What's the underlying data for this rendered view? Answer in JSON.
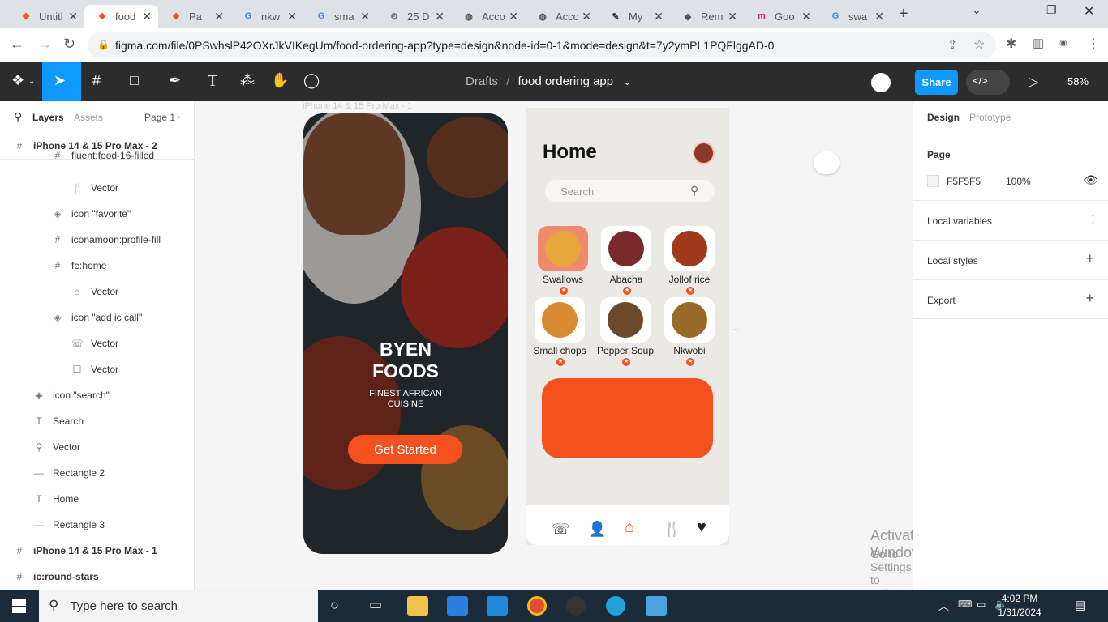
{
  "browser": {
    "tabs": [
      {
        "title": "Untitled",
        "favicon": "figma-icon"
      },
      {
        "title": "food ordering app",
        "favicon": "figma-icon",
        "active": true
      },
      {
        "title": "Pa",
        "favicon": "figma-icon"
      },
      {
        "title": "nkw",
        "favicon": "google-icon"
      },
      {
        "title": "sma",
        "favicon": "google-icon"
      },
      {
        "title": "25 D",
        "favicon": "tool-icon"
      },
      {
        "title": "Acco",
        "favicon": "globe-icon"
      },
      {
        "title": "Acco",
        "favicon": "globe-icon"
      },
      {
        "title": "My",
        "favicon": "pen-icon"
      },
      {
        "title": "Rem",
        "favicon": "layers-icon"
      },
      {
        "title": "Goo",
        "favicon": "m-icon"
      },
      {
        "title": "swa",
        "favicon": "google-icon"
      }
    ],
    "url": "figma.com/file/0PSwhslP42OXrJkVIKegUm/food-ordering-app?type=design&node-id=0-1&mode=design&t=7y2ymPL1PQFlggAD-0"
  },
  "figma": {
    "breadcrumb_parent": "Drafts",
    "breadcrumb_sep": "/",
    "file_name": "food ordering app",
    "share_label": "Share",
    "zoom": "58%"
  },
  "left_panel": {
    "tab_layers": "Layers",
    "tab_assets": "Assets",
    "page_selector": "Page 1",
    "layers": [
      {
        "name": "iPhone 14 & 15 Pro Max - 2",
        "icon": "#",
        "indent": 0,
        "bold": true
      },
      {
        "name": "fluent:food-16-filled",
        "icon": "#",
        "indent": 2
      },
      {
        "name": "Vector",
        "icon": "🍴",
        "indent": 3
      },
      {
        "name": "icon \"favorite\"",
        "icon": "◈",
        "indent": 2
      },
      {
        "name": "iconamoon:profile-fill",
        "icon": "#",
        "indent": 2
      },
      {
        "name": "fe:home",
        "icon": "#",
        "indent": 2
      },
      {
        "name": "Vector",
        "icon": "⌂",
        "indent": 3
      },
      {
        "name": "icon \"add ic call\"",
        "icon": "◈",
        "indent": 2
      },
      {
        "name": "Vector",
        "icon": "☏",
        "indent": 3
      },
      {
        "name": "Vector",
        "icon": "☐",
        "indent": 3
      },
      {
        "name": "icon \"search\"",
        "icon": "◈",
        "indent": 1
      },
      {
        "name": "Search",
        "icon": "T",
        "indent": 1
      },
      {
        "name": "Vector",
        "icon": "⚲",
        "indent": 1
      },
      {
        "name": "Rectangle 2",
        "icon": "—",
        "indent": 1
      },
      {
        "name": "Home",
        "icon": "T",
        "indent": 1
      },
      {
        "name": "Rectangle 3",
        "icon": "—",
        "indent": 1
      },
      {
        "name": "iPhone 14 & 15 Pro Max - 1",
        "icon": "#",
        "indent": 0,
        "bold": true
      },
      {
        "name": "ic:round-stars",
        "icon": "#",
        "indent": 0,
        "bold": true
      }
    ]
  },
  "canvas": {
    "frame_label": "iPhone 14 & 15 Pro Max - 1",
    "splash": {
      "brand_line1": "BYEN",
      "brand_line2": "FOODS",
      "tagline_line1": "FINEST AFRICAN",
      "tagline_line2": "CUISINE",
      "cta": "Get Started"
    },
    "home": {
      "title": "Home",
      "search_placeholder": "Search",
      "categories": [
        "Swallows",
        "Abacha",
        "Jollof rice",
        "Small chops",
        "Pepper Soup",
        "Nkwobi"
      ],
      "accent_color": "#F4511E"
    },
    "watermark_line1": "Activate Windows",
    "watermark_line2": "Go to Settings to activate Windows."
  },
  "right_panel": {
    "tab_design": "Design",
    "tab_prototype": "Prototype",
    "page_label": "Page",
    "page_color": "F5F5F5",
    "page_opacity": "100%",
    "local_variables": "Local variables",
    "local_styles": "Local styles",
    "export": "Export"
  },
  "taskbar": {
    "search_placeholder": "Type here to search",
    "time": "4:02 PM",
    "date": "1/31/2024"
  }
}
